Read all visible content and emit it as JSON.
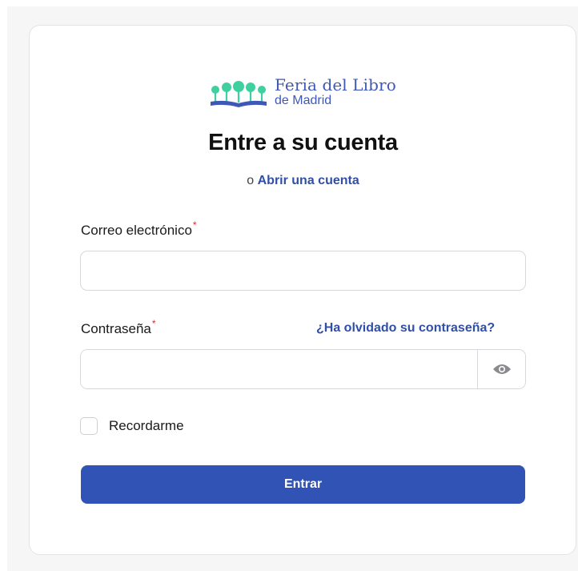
{
  "logo": {
    "line1": "Feria del Libro",
    "line2": "de Madrid",
    "icon": "book-trees-icon",
    "colors": {
      "trees": "#3fd0a0",
      "book": "#3e58b8"
    }
  },
  "login": {
    "title": "Entre a su cuenta",
    "subtitle_prefix": "o",
    "create_account_link": "Abrir una cuenta",
    "email_label": "Correo electrónico",
    "email_value": "",
    "password_label": "Contraseña",
    "password_value": "",
    "required_marker": "*",
    "forgot_link": "¿Ha olvidado su contraseña?",
    "toggle_visibility_icon": "eye-icon",
    "remember_label": "Recordarme",
    "remember_checked": false,
    "submit_label": "Entrar"
  },
  "colors": {
    "accent": "#3153b5",
    "link": "#2f4fa8",
    "required": "#e02424"
  }
}
